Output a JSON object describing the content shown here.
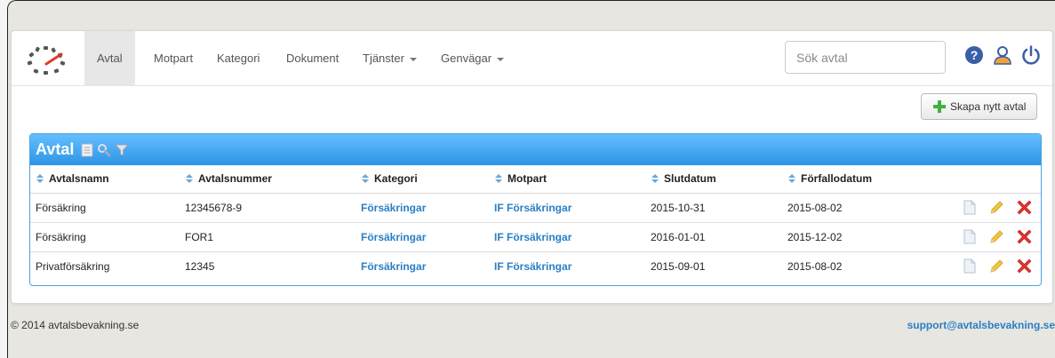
{
  "nav": {
    "items": [
      {
        "label": "Avtal",
        "active": true,
        "dropdown": false
      },
      {
        "label": "Motpart",
        "active": false,
        "dropdown": false
      },
      {
        "label": "Kategori",
        "active": false,
        "dropdown": false
      },
      {
        "label": "Dokument",
        "active": false,
        "dropdown": false
      },
      {
        "label": "Tjänster",
        "active": false,
        "dropdown": true
      },
      {
        "label": "Genvägar",
        "active": false,
        "dropdown": true
      }
    ],
    "search_placeholder": "Sök avtal",
    "icons": [
      "help-icon",
      "user-icon",
      "power-icon"
    ]
  },
  "toolbar": {
    "create_label": "Skapa nytt avtal"
  },
  "panel": {
    "title": "Avtal",
    "title_icons": [
      "document-icon",
      "search-icon",
      "filter-icon"
    ]
  },
  "table": {
    "columns": [
      "Avtalsnamn",
      "Avtalsnummer",
      "Kategori",
      "Motpart",
      "Slutdatum",
      "Förfallodatum"
    ],
    "rows": [
      [
        "Försäkring",
        "12345678-9",
        "Försäkringar",
        "IF Försäkringar",
        "2015-10-31",
        "2015-08-02"
      ],
      [
        "Försäkring",
        "FOR1",
        "Försäkringar",
        "IF Försäkringar",
        "2016-01-01",
        "2015-12-02"
      ],
      [
        "Privatförsäkring",
        "12345",
        "Försäkringar",
        "IF Försäkringar",
        "2015-09-01",
        "2015-08-02"
      ]
    ],
    "row_actions": [
      "view-icon",
      "edit-icon",
      "delete-icon"
    ]
  },
  "footer": {
    "copyright": "© 2014 avtalsbevakning.se",
    "support": "support@avtalsbevakning.se"
  },
  "colors": {
    "accent": "#2d94e6",
    "link": "#2a7fc4",
    "success": "#3fb13f",
    "danger": "#e2342a"
  }
}
